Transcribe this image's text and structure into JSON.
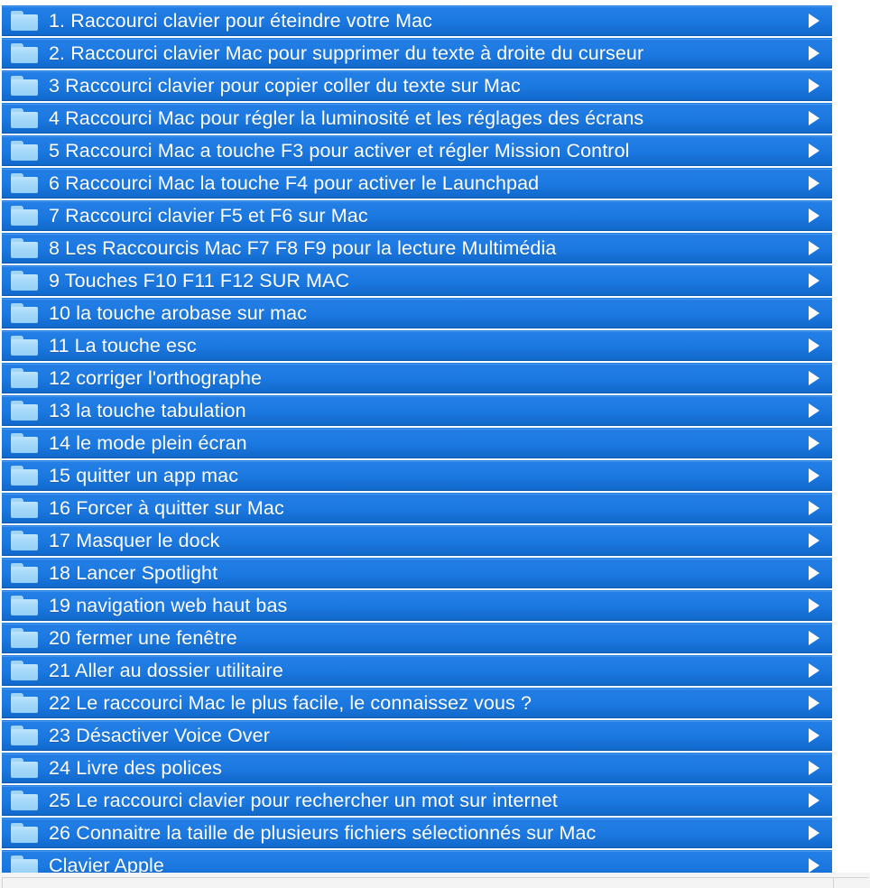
{
  "window": {
    "background_color": "#ffffff",
    "row_color": "#1b78e0",
    "row_text_color": "#ffffff",
    "folder_icon_color": "#a9dbfb",
    "arrow_color": "#ffffff"
  },
  "list": {
    "icon_name": "folder-icon",
    "disclosure_icon_name": "chevron-right-icon",
    "items": [
      {
        "label": "1. Raccourci clavier pour éteindre votre Mac"
      },
      {
        "label": "2. Raccourci clavier Mac pour supprimer du texte à droite du curseur"
      },
      {
        "label": "3 Raccourci clavier pour copier coller du texte sur Mac"
      },
      {
        "label": "4 Raccourci Mac pour régler la luminosité et les réglages des écrans"
      },
      {
        "label": "5 Raccourci Mac a touche F3 pour activer et régler Mission Control"
      },
      {
        "label": "6 Raccourci Mac la touche F4 pour activer le Launchpad"
      },
      {
        "label": "7 Raccourci clavier F5 et F6 sur Mac"
      },
      {
        "label": "8 Les Raccourcis Mac F7 F8 F9 pour la lecture Multimédia"
      },
      {
        "label": "9 Touches F10 F11 F12 SUR MAC"
      },
      {
        "label": "10 la touche arobase sur mac"
      },
      {
        "label": "11 La touche esc"
      },
      {
        "label": "12 corriger l'orthographe"
      },
      {
        "label": "13 la touche tabulation"
      },
      {
        "label": "14 le mode plein écran"
      },
      {
        "label": "15 quitter un app mac"
      },
      {
        "label": "16 Forcer à quitter sur Mac"
      },
      {
        "label": "17 Masquer le dock"
      },
      {
        "label": "18 Lancer Spotlight"
      },
      {
        "label": "19 navigation web haut bas"
      },
      {
        "label": "20 fermer une fenêtre"
      },
      {
        "label": "21 Aller au dossier utilitaire"
      },
      {
        "label": "22 Le raccourci Mac le plus facile, le connaissez vous ?"
      },
      {
        "label": "23 Désactiver Voice Over"
      },
      {
        "label": "24 Livre des polices"
      },
      {
        "label": "25 Le raccourci clavier pour rechercher un mot sur internet"
      },
      {
        "label": "26 Connaitre la taille de plusieurs fichiers sélectionnés sur Mac"
      },
      {
        "label": "Clavier Apple"
      }
    ]
  }
}
